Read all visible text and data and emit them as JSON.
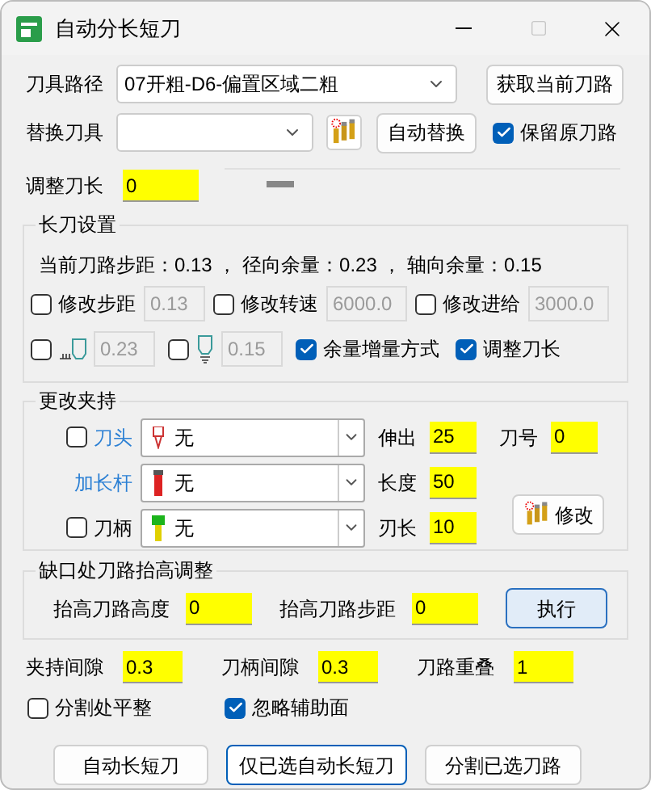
{
  "window": {
    "title": "自动分长短刀",
    "maximize_disabled": true
  },
  "tool_path": {
    "label": "刀具路径",
    "value": "07开粗-D6-偏置区域二粗",
    "button": "获取当前刀路"
  },
  "replace_tool": {
    "label": "替换刀具",
    "button": "自动替换",
    "keep": {
      "label": "保留原刀路",
      "checked": true
    }
  },
  "adjust_length": {
    "label": "调整刀长",
    "value": "0",
    "level": 0.07
  },
  "long_tool": {
    "title": "长刀设置",
    "info": "当前刀路步距：0.13 ， 径向余量：0.23 ， 轴向余量：0.15",
    "row1": [
      {
        "checked": false,
        "label": "修改步距",
        "value": "0.13",
        "disabled": true
      },
      {
        "checked": false,
        "label": "修改转速",
        "value": "6000.0",
        "disabled": true
      },
      {
        "checked": false,
        "label": "修改进给",
        "value": "3000.0",
        "disabled": true
      }
    ],
    "row2": [
      {
        "kind": "radial",
        "checked": false,
        "value": "0.23",
        "disabled": true
      },
      {
        "kind": "axial",
        "checked": false,
        "value": "0.15",
        "disabled": true
      },
      {
        "kind": "check",
        "checked": true,
        "label": "余量增量方式"
      },
      {
        "kind": "check",
        "checked": true,
        "label": "调整刀长"
      }
    ]
  },
  "holder": {
    "title": "更改夹持",
    "rows": [
      {
        "kind": "head",
        "checked": false,
        "label": "刀头",
        "color": "#2a7fd4",
        "value": "无"
      },
      {
        "kind": "extension",
        "label": "加长杆",
        "color": "#2a7fd4",
        "value": "无"
      },
      {
        "kind": "shank",
        "checked": false,
        "label": "刀柄",
        "color": "#000000",
        "value": "无"
      }
    ],
    "fields": [
      {
        "label": "伸出",
        "value": "25"
      },
      {
        "label": "长度",
        "value": "50"
      },
      {
        "label": "刃长",
        "value": "10"
      }
    ],
    "tool_number": {
      "label": "刀号",
      "value": "0"
    },
    "modify_button": "修改"
  },
  "lift": {
    "title": "缺口处刀路抬高调整",
    "height": {
      "label": "抬高刀路高度",
      "value": "0"
    },
    "step": {
      "label": "抬高刀路步距",
      "value": "0"
    },
    "button": "执行"
  },
  "gaps": [
    {
      "label": "夹持间隙",
      "value": "0.3"
    },
    {
      "label": "刀柄间隙",
      "value": "0.3"
    },
    {
      "label": "刀路重叠",
      "value": "1"
    }
  ],
  "options": [
    {
      "label": "分割处平整",
      "checked": false
    },
    {
      "label": "忽略辅助面",
      "checked": true
    }
  ],
  "buttons": [
    {
      "label": "自动长短刀",
      "selected": false
    },
    {
      "label": "仅已选自动长短刀",
      "selected": true
    },
    {
      "label": "分割已选刀路",
      "selected": false
    }
  ]
}
